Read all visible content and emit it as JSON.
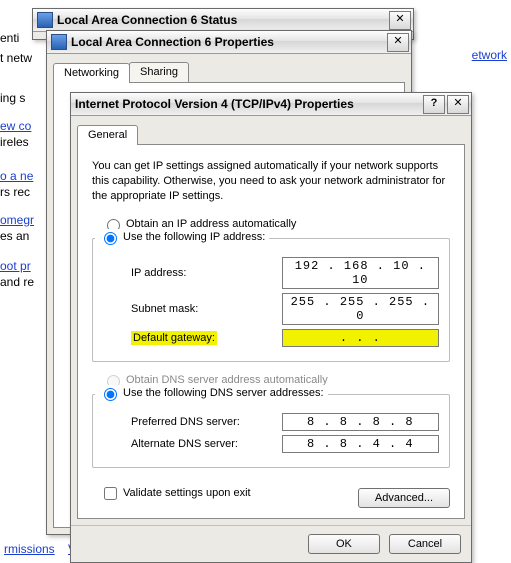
{
  "bg": {
    "t1": "enti",
    "t2": "t netw",
    "t3": "ing s",
    "t4": "ew co",
    "t5": "ireles",
    "t6": "o a ne",
    "t7": "rs rec",
    "t8": "omegr",
    "t9": "es an",
    "t10": "oot pr",
    "t11": "and re",
    "link1": "rmissions",
    "link2": "Visit website",
    "bgLinkRight": "etwork"
  },
  "winStatus": {
    "title": "Local Area Connection 6 Status"
  },
  "winProps": {
    "title": "Local Area Connection 6 Properties",
    "tabs": {
      "networking": "Networking",
      "sharing": "Sharing"
    }
  },
  "tcp": {
    "title": "Internet Protocol Version 4 (TCP/IPv4) Properties",
    "tab": "General",
    "desc": "You can get IP settings assigned automatically if your network supports this capability. Otherwise, you need to ask your network administrator for the appropriate IP settings.",
    "rObtainIp": "Obtain an IP address automatically",
    "rUseIp": "Use the following IP address:",
    "ipLabel": "IP address:",
    "ipVal": "192 . 168 . 10 . 10",
    "subnetLabel": "Subnet mask:",
    "subnetVal": "255 . 255 . 255 .  0",
    "gwLabel": "Default gateway:",
    "gwVal": " .     .     . ",
    "rObtainDns": "Obtain DNS server address automatically",
    "rUseDns": "Use the following DNS server addresses:",
    "prefDnsLabel": "Preferred DNS server:",
    "prefDnsVal": " 8  .  8  .  8  .  8",
    "altDnsLabel": "Alternate DNS server:",
    "altDnsVal": " 8  .  8  .  4  .  4",
    "validate": "Validate settings upon exit",
    "advanced": "Advanced...",
    "ok": "OK",
    "cancel": "Cancel"
  }
}
